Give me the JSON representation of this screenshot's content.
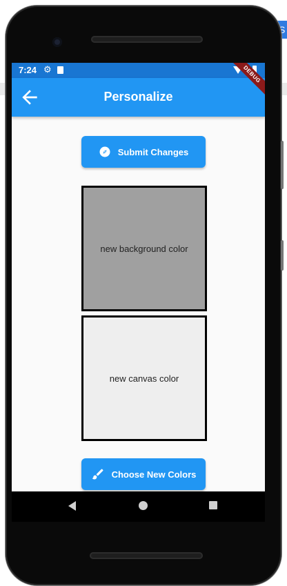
{
  "host": {
    "tab_label": "S"
  },
  "status_bar": {
    "time": "7:24"
  },
  "debug_banner": "DEBUG",
  "app_bar": {
    "title": "Personalize",
    "back_icon": "arrow-back-icon"
  },
  "buttons": {
    "submit": {
      "label": "Submit Changes",
      "icon": "compass-icon"
    },
    "choose": {
      "label": "Choose New Colors",
      "icon": "brush-icon"
    }
  },
  "swatches": {
    "background": {
      "label": "new background color",
      "color": "#a0a0a0"
    },
    "canvas": {
      "label": "new canvas color",
      "color": "#eeeeee"
    }
  },
  "colors": {
    "primary": "#2196f3",
    "status_bar": "#1976d2"
  }
}
